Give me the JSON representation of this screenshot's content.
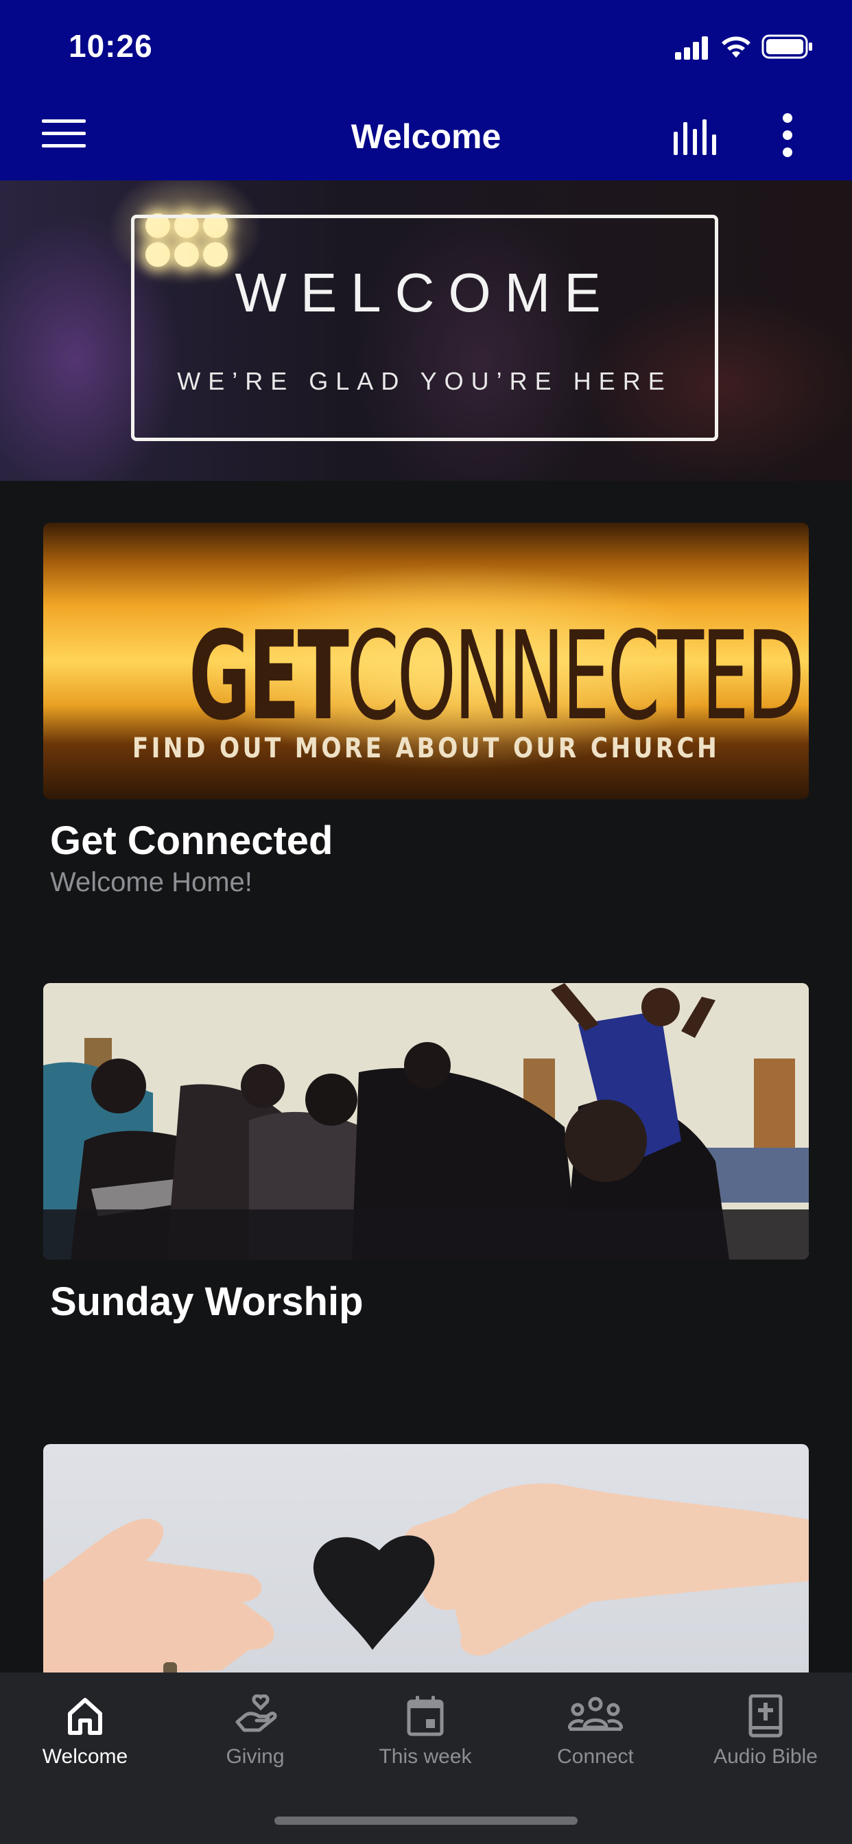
{
  "status_bar": {
    "time": "10:26"
  },
  "nav": {
    "title": "Welcome"
  },
  "hero": {
    "title": "WELCOME",
    "subtitle": "WE’RE GLAD YOU’RE HERE"
  },
  "cards": [
    {
      "banner_bold": "GET",
      "banner_rest": "CONNECTED",
      "banner_tagline": "FIND OUT MORE ABOUT OUR CHURCH",
      "title": "Get Connected",
      "subtitle": "Welcome Home!"
    },
    {
      "title": "Sunday Worship"
    },
    {
      "title": ""
    }
  ],
  "tabs": [
    {
      "label": "Welcome",
      "icon": "home-icon",
      "active": true
    },
    {
      "label": "Giving",
      "icon": "giving-hand-heart-icon"
    },
    {
      "label": "This week",
      "icon": "calendar-icon"
    },
    {
      "label": "Connect",
      "icon": "group-people-icon"
    },
    {
      "label": "Audio Bible",
      "icon": "bible-cross-icon"
    }
  ],
  "colors": {
    "nav_bar": "#04078a",
    "background": "#131416",
    "tab_bar": "#232427",
    "tab_inactive": "#8e8f94"
  }
}
